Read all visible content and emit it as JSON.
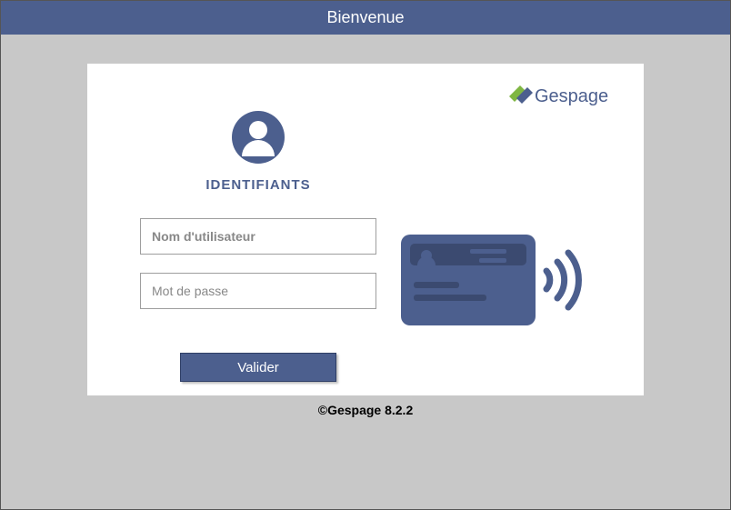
{
  "header": {
    "title": "Bienvenue"
  },
  "brand": {
    "name": "Gespage"
  },
  "login": {
    "section_label": "IDENTIFIANTS",
    "username_placeholder": "Nom d'utilisateur",
    "password_placeholder": "Mot de passe",
    "submit_label": "Valider"
  },
  "footer": {
    "text": "©Gespage 8.2.2"
  },
  "colors": {
    "primary": "#4c5f8e",
    "accent_green": "#7fb642"
  }
}
